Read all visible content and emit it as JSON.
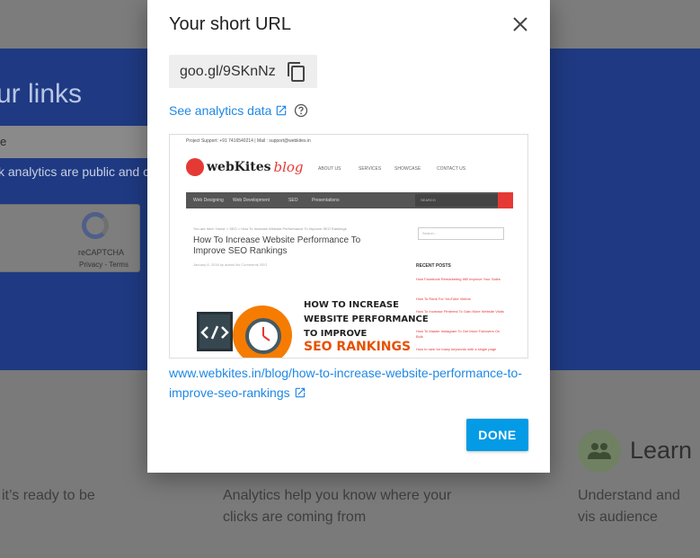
{
  "background": {
    "hero_title": "ur links",
    "hero_input_text": "e",
    "hero_note": "k analytics are public and c",
    "recaptcha": {
      "label": "reCAPTCHA",
      "links": "Privacy - Terms"
    },
    "features": [
      {
        "text": "it’s ready to be"
      },
      {
        "text": "Analytics help you know where your clicks are coming from"
      },
      {
        "title": "Learn",
        "text": "Understand and vis audience"
      }
    ]
  },
  "dialog": {
    "title": "Your short URL",
    "short_url": "goo.gl/9SKnNz",
    "analytics_link": "See analytics data",
    "long_url": "www.webkites.in/blog/how-to-increase-website-performance-to-improve-seo-rankings",
    "done_label": "DONE",
    "preview": {
      "support": "Project Support: +91 7416540214 | Mail : support@webkites.in",
      "logo_word": "webKites",
      "logo_blog": "blog",
      "nav": [
        "ABOUT US",
        "SERVICES",
        "SHOWCASE",
        "CONTACT US"
      ],
      "menu": [
        "Web Designing",
        "Web Development",
        "SEO",
        "Presentations"
      ],
      "search_placeholder": "SEARCH",
      "breadcrumb": "You are here: Home > SEO > How To Increase Website Performance To Improve SEO Rankings",
      "article_title": "How To Increase Website Performance To Improve SEO Rankings",
      "meta": "January 8, 2018 by admin   No Comments   SEO",
      "sidebar_search": "Search...",
      "recent_posts_heading": "RECENT POSTS",
      "recent_posts": [
        "How Facebook Remarketing Will Improve Your Sales",
        "How To Rank For YouTube Videos",
        "How To Increase Pinterest To Gain More Website Visits",
        "How To Master Instagram To Get More Followers On Bulk",
        "How to rank for many keywords with a single page"
      ],
      "headline_lines": [
        "HOW TO INCREASE",
        "WEBSITE PERFORMANCE",
        "TO IMPROVE"
      ],
      "headline_orange": "SEO RANKINGS"
    }
  },
  "colors": {
    "link": "#1e88e5",
    "done_button": "#039be5",
    "hero_background": "#1f3a82"
  }
}
